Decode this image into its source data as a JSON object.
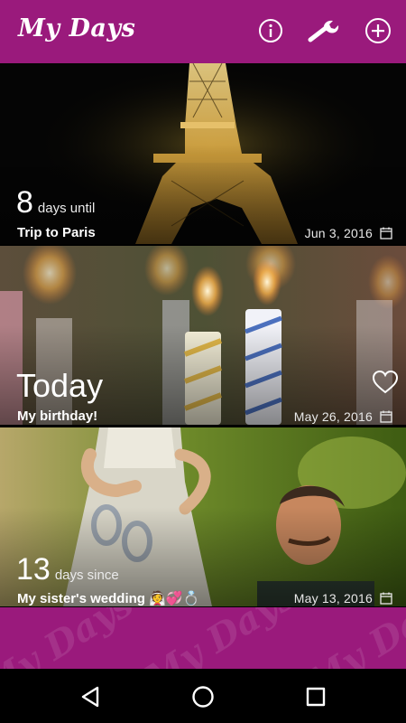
{
  "app": {
    "title": "My Days",
    "accent_color": "#9a1a7c",
    "actions": [
      {
        "icon": "info-icon"
      },
      {
        "icon": "wrench-icon"
      },
      {
        "icon": "add-circle-icon"
      }
    ]
  },
  "events": [
    {
      "count": "8",
      "unit": "days until",
      "name": "Trip to Paris",
      "date": "Jun 3, 2016",
      "image_subject": "Eiffel Tower at night"
    },
    {
      "count": "Today",
      "name": "My birthday!",
      "date": "May 26, 2016",
      "image_subject": "birthday candles",
      "favorite_icon": "heart-outline-icon"
    },
    {
      "count": "13",
      "unit": "days since",
      "name": "My sister's wedding 👰💞💍",
      "date": "May 13, 2016",
      "image_subject": "bride and groom figurines"
    }
  ],
  "footer": {
    "watermark_text": "My Days"
  },
  "navbar": {
    "buttons": [
      {
        "icon": "back-triangle-icon"
      },
      {
        "icon": "home-circle-icon"
      },
      {
        "icon": "recents-square-icon"
      }
    ]
  }
}
